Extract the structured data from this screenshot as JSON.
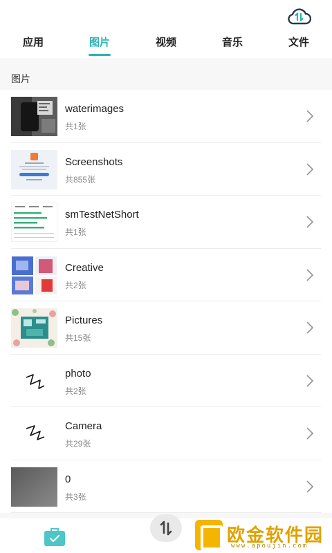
{
  "header": {
    "cloud_icon": "cloud-transfer-icon"
  },
  "tabs": [
    {
      "label": "应用",
      "active": false
    },
    {
      "label": "图片",
      "active": true
    },
    {
      "label": "视频",
      "active": false
    },
    {
      "label": "音乐",
      "active": false
    },
    {
      "label": "文件",
      "active": false
    }
  ],
  "section": {
    "title": "图片"
  },
  "albums": [
    {
      "name": "waterimages",
      "count": "共1张",
      "thumb": "dark-photo"
    },
    {
      "name": "Screenshots",
      "count": "共855张",
      "thumb": "screenshot"
    },
    {
      "name": "smTestNetShort",
      "count": "共1张",
      "thumb": "table"
    },
    {
      "name": "Creative",
      "count": "共2张",
      "thumb": "creative"
    },
    {
      "name": "Pictures",
      "count": "共15张",
      "thumb": "floral"
    },
    {
      "name": "photo",
      "count": "共2张",
      "thumb": "scribble"
    },
    {
      "name": "Camera",
      "count": "共29张",
      "thumb": "scribble"
    },
    {
      "name": "0",
      "count": "共3张",
      "thumb": "gray"
    }
  ],
  "bottom": {
    "left_icon": "bag-check-icon",
    "center_icon": "transfer-icon"
  },
  "watermark": {
    "text": "欧金软件园",
    "url": "www.apoujin.com"
  },
  "colors": {
    "accent": "#2cb4b4",
    "bag": "#4cc6c6",
    "watermark": "#e0a100"
  }
}
